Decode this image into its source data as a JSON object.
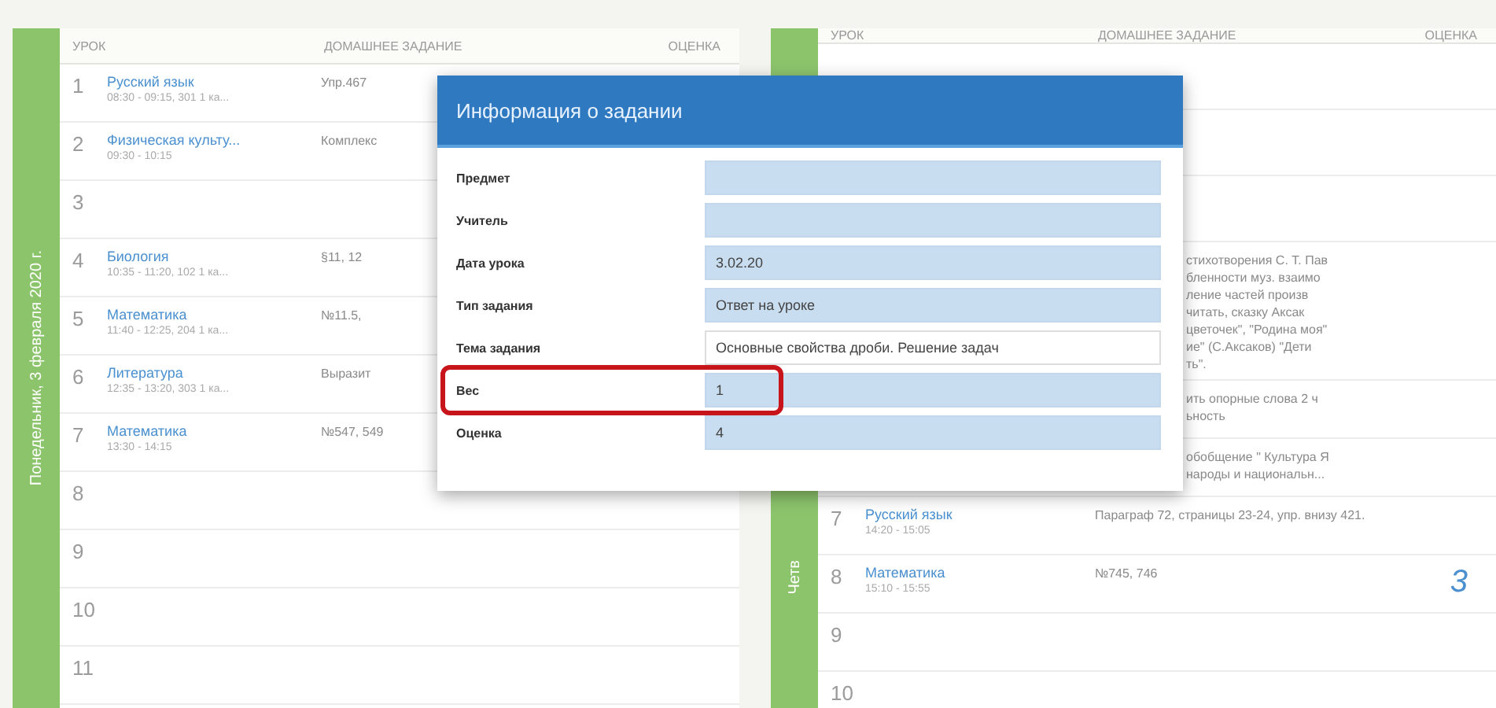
{
  "left_day": {
    "label": "Понедельник, 3 февраля 2020 г.",
    "columns": [
      "УРОК",
      "ДОМАШНЕЕ ЗАДАНИЕ",
      "ОЦЕНКА"
    ],
    "rows": [
      {
        "number": "1",
        "subject": "Русский язык",
        "time": "08:30 - 09:15, 301 1 ка...",
        "homework": "Упр.467"
      },
      {
        "number": "2",
        "subject": "Физическая культу...",
        "time": "09:30 - 10:15",
        "homework": "Комплекс"
      },
      {
        "number": "3"
      },
      {
        "number": "4",
        "subject": "Биология",
        "time": "10:35 - 11:20, 102 1 ка...",
        "homework": "§11, 12"
      },
      {
        "number": "5",
        "subject": "Математика",
        "time": "11:40 - 12:25, 204 1 ка...",
        "homework": "№11.5,"
      },
      {
        "number": "6",
        "subject": "Литература",
        "time": "12:35 - 13:20, 303 1 ка...",
        "homework": "Выразит"
      },
      {
        "number": "7",
        "subject": "Математика",
        "time": "13:30 - 14:15",
        "homework": "№547, 549"
      },
      {
        "number": "8"
      },
      {
        "number": "9"
      },
      {
        "number": "10"
      },
      {
        "number": "11"
      }
    ]
  },
  "right_day": {
    "label": "Четв",
    "columns": [
      "УРОК",
      "ДОМАШНЕЕ ЗАДАНИЕ",
      "ОЦЕНКА"
    ],
    "rows": [
      {},
      {},
      {},
      {
        "homework_lines": [
          "стихотворения С. Т. Пав",
          "бленности муз. взаимо",
          "ление частей произв",
          "читать, сказку Аксак",
          "цветочек\", \"Родина моя\"",
          "ие\" (С.Аксаков) \"Дети",
          "ть\"."
        ]
      },
      {
        "homework_lines": [
          "ить опорные слова 2 ч",
          "ьность"
        ]
      },
      {
        "homework_lines": [
          "обобщение \" Культура Я",
          "народы и национальн..."
        ]
      },
      {
        "number": "7",
        "subject": "Русский язык",
        "time": "14:20 - 15:05",
        "homework": "Параграф 72, страницы 23-24, упр. внизу 421."
      },
      {
        "number": "8",
        "subject": "Математика",
        "time": "15:10 - 15:55",
        "homework": "№745, 746",
        "grade": "3"
      },
      {
        "number": "9"
      },
      {
        "number": "10"
      }
    ]
  },
  "dialog": {
    "title": "Информация о задании",
    "fields": [
      {
        "label": "Предмет",
        "kind": "filled",
        "highlighted": false
      },
      {
        "label": "Учитель",
        "kind": "filled",
        "highlighted": false
      },
      {
        "label": "Дата урока",
        "value": "3.02.20",
        "kind": "filled",
        "highlighted": false
      },
      {
        "label": "Тип задания",
        "value": "Ответ на уроке",
        "kind": "filled",
        "highlighted": false
      },
      {
        "label": "Тема задания",
        "value": "Основные свойства дроби. Решение задач",
        "kind": "plain",
        "highlighted": false
      },
      {
        "label": "Вес",
        "value": "1",
        "kind": "filled",
        "highlighted": true
      },
      {
        "label": "Оценка",
        "value": "4",
        "kind": "filled",
        "highlighted": false
      }
    ]
  }
}
